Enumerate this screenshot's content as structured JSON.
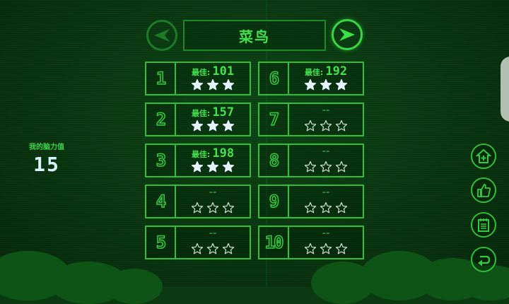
{
  "header": {
    "title": "菜鸟"
  },
  "player": {
    "power_label": "我的脑力值",
    "power_value": "15"
  },
  "levels": [
    {
      "number": "1",
      "best_label": "最佳:",
      "best_score": "101",
      "stars": 3
    },
    {
      "number": "2",
      "best_label": "最佳:",
      "best_score": "157",
      "stars": 3
    },
    {
      "number": "3",
      "best_label": "最佳:",
      "best_score": "198",
      "stars": 3
    },
    {
      "number": "4",
      "empty_score": "--",
      "stars": 0
    },
    {
      "number": "5",
      "empty_score": "--",
      "stars": 0
    },
    {
      "number": "6",
      "best_label": "最佳:",
      "best_score": "192",
      "stars": 3
    },
    {
      "number": "7",
      "empty_score": "--",
      "stars": 0
    },
    {
      "number": "8",
      "empty_score": "--",
      "stars": 0
    },
    {
      "number": "9",
      "empty_score": "--",
      "stars": 0
    },
    {
      "number": "10",
      "empty_score": "--",
      "stars": 0
    }
  ],
  "side_buttons": [
    "add-to-home-icon",
    "thumbs-up-icon",
    "notepad-icon",
    "return-icon"
  ],
  "colors": {
    "accent": "#46e04f",
    "border": "#2fbf3a",
    "star_filled": "#e6f3ff"
  }
}
